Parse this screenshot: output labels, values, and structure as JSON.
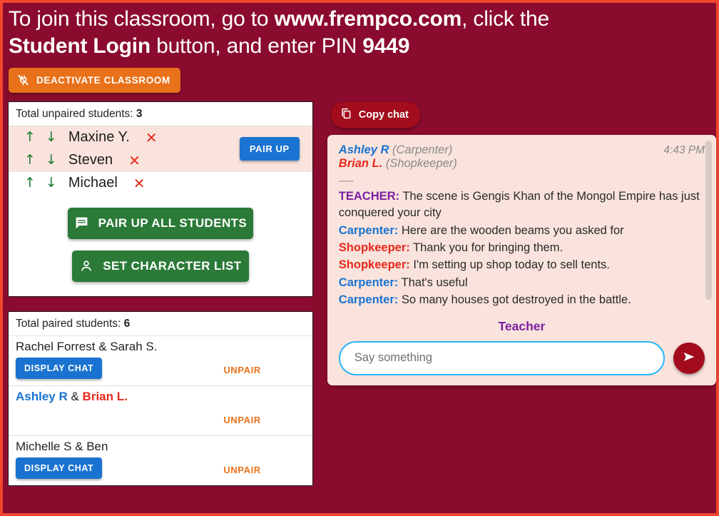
{
  "banner": {
    "line1_a": "To join this classroom, go to ",
    "line1_b": "www.frempco.com",
    "line1_c": ", click the",
    "line2_a": "Student Login",
    "line2_b": " button, and enter PIN ",
    "line2_c": "9449"
  },
  "toolbar": {
    "deactivate_label": "DEACTIVATE CLASSROOM",
    "deactivate_icon": "power-off-icon"
  },
  "unpaired": {
    "title_text": "Total unpaired students: ",
    "count": "3",
    "pair_up_label": "PAIR UP",
    "up_arrow": "↑",
    "down_arrow": "↓",
    "remove_mark": "✕",
    "students": [
      {
        "name": "Maxine Y.",
        "selected": true
      },
      {
        "name": "Steven",
        "selected": true
      },
      {
        "name": "Michael",
        "selected": false
      }
    ]
  },
  "actions": {
    "pair_all_label": "PAIR UP ALL STUDENTS",
    "pair_all_icon": "chat-bubble-icon",
    "set_characters_label": "SET CHARACTER LIST",
    "set_characters_icon": "person-icon"
  },
  "paired": {
    "title_text": "Total paired students: ",
    "count": "6",
    "display_chat_label": "DISPLAY CHAT",
    "unpair_label": "UNPAIR",
    "rows": [
      {
        "name_a": "Rachel Forrest",
        "amp": " & ",
        "name_b": "Sarah S.",
        "style_a": "plain",
        "style_b": "plain",
        "has_display_chat": true
      },
      {
        "name_a": "Ashley R",
        "amp": " & ",
        "name_b": "Brian L.",
        "style_a": "blue",
        "style_b": "red",
        "has_display_chat": false
      },
      {
        "name_a": "Michelle S",
        "amp": " & ",
        "name_b": "Ben",
        "style_a": "plain",
        "style_b": "plain",
        "has_display_chat": true
      }
    ]
  },
  "chat": {
    "copy_label": "Copy chat",
    "copy_icon": "copy-icon",
    "participant_a_name": "Ashley R",
    "participant_a_role": " (Carpenter)",
    "participant_b_name": "Brian L.",
    "participant_b_role": " (Shopkeeper)",
    "time": "4:43 PM",
    "separator": "-----",
    "messages": [
      {
        "speaker": "TEACHER:",
        "speaker_class": "spk-teacher",
        "text": " The scene is Gengis Khan of the Mongol Empire has just conquered your city"
      },
      {
        "speaker": "Carpenter:",
        "speaker_class": "spk-carp",
        "text": " Here are the wooden beams you asked for"
      },
      {
        "speaker": "Shopkeeper:",
        "speaker_class": "spk-shop",
        "text": " Thank you for bringing them."
      },
      {
        "speaker": "Shopkeeper:",
        "speaker_class": "spk-shop",
        "text": " I'm setting up shop today to sell tents."
      },
      {
        "speaker": "Carpenter:",
        "speaker_class": "spk-carp",
        "text": " That's useful"
      },
      {
        "speaker": "Carpenter:",
        "speaker_class": "spk-carp",
        "text": " So many houses got destroyed in the battle."
      }
    ],
    "teacher_label": "Teacher",
    "input_value": "",
    "input_placeholder": "Say something",
    "send_icon": "send-icon"
  },
  "colors": {
    "page_bg": "#8a0b2e",
    "page_border": "#f4452f",
    "orange": "#e8711a",
    "green": "#2b7a38",
    "blue": "#1a73d1",
    "red": "#e8291c",
    "purple": "#7b1fa2",
    "chat_bg": "#f9e3dc",
    "dark_red": "#a30c1c"
  }
}
